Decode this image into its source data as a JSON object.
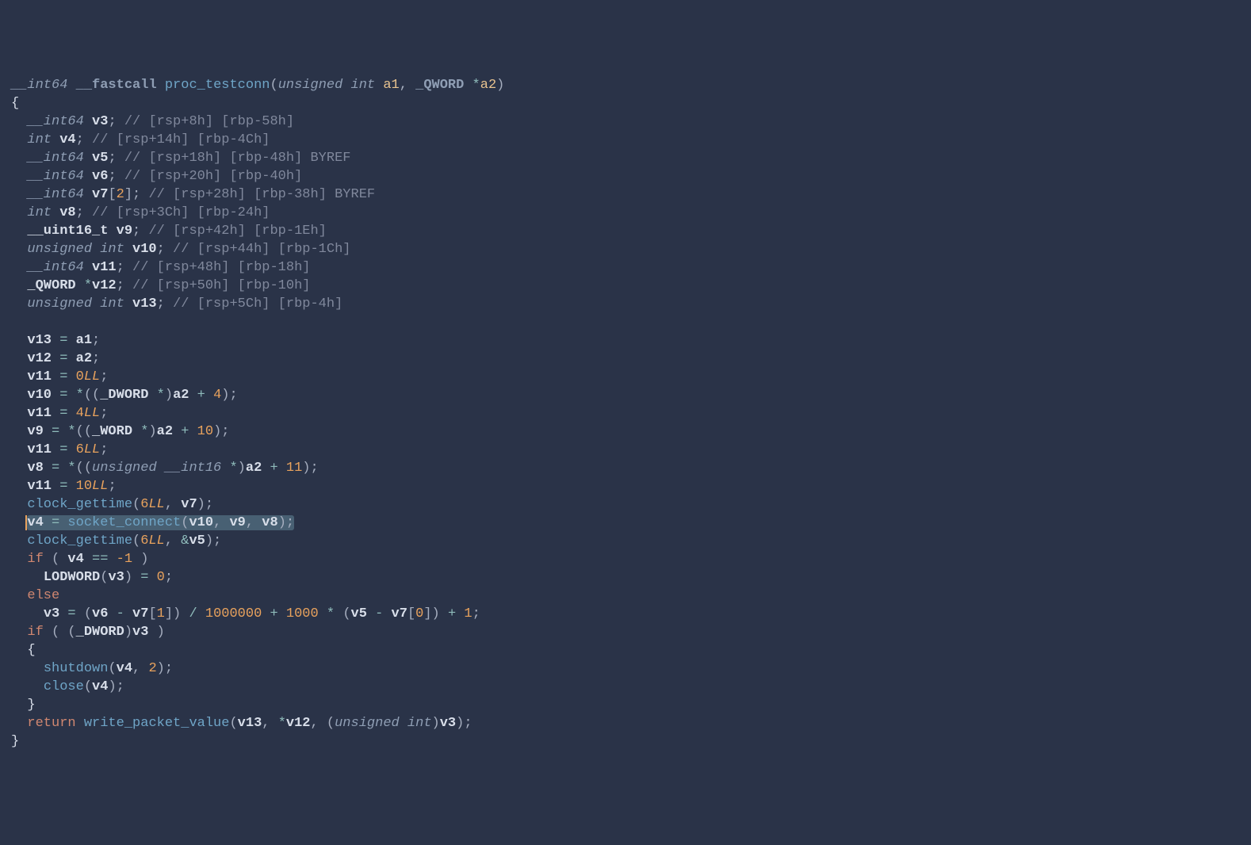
{
  "sig": {
    "ret": "__int64",
    "cc": "__fastcall",
    "name": "proc_testconn",
    "p1t": "unsigned int",
    "p1": "a1",
    "p2t": "_QWORD",
    "p2": "a2"
  },
  "decls": {
    "v3": {
      "t": "__int64",
      "c": "// [rsp+8h] [rbp-58h]"
    },
    "v4": {
      "t": "int",
      "c": "// [rsp+14h] [rbp-4Ch]"
    },
    "v5": {
      "t": "__int64",
      "c": "// [rsp+18h] [rbp-48h] BYREF"
    },
    "v6": {
      "t": "__int64",
      "c": "// [rsp+20h] [rbp-40h]"
    },
    "v7": {
      "t": "__int64",
      "arr": "2",
      "c": "// [rsp+28h] [rbp-38h] BYREF"
    },
    "v8": {
      "t": "int",
      "c": "// [rsp+3Ch] [rbp-24h]"
    },
    "v9": {
      "t": "__uint16_t",
      "c": "// [rsp+42h] [rbp-1Eh]"
    },
    "v10": {
      "t": "unsigned int",
      "c": "// [rsp+44h] [rbp-1Ch]"
    },
    "v11": {
      "t": "__int64",
      "c": "// [rsp+48h] [rbp-18h]"
    },
    "v12": {
      "t": "_QWORD",
      "ptr": "*",
      "c": "// [rsp+50h] [rbp-10h]"
    },
    "v13": {
      "t": "unsigned int",
      "c": "// [rsp+5Ch] [rbp-4h]"
    }
  },
  "body": {
    "l1": "v13",
    "l1b": "a1",
    "l2": "v12",
    "l2b": "a2",
    "l3": "v11",
    "l3n": "0",
    "l3s": "LL",
    "l4": "v10",
    "l4cast": "_DWORD",
    "l4b": "a2",
    "l4n": "4",
    "l5": "v11",
    "l5n": "4",
    "l5s": "LL",
    "l6": "v9",
    "l6cast": "_WORD",
    "l6b": "a2",
    "l6n": "10",
    "l7": "v11",
    "l7n": "6",
    "l7s": "LL",
    "l8": "v8",
    "l8cast": "unsigned __int16",
    "l8b": "a2",
    "l8n": "11",
    "l9": "v11",
    "l9n": "10",
    "l9s": "LL",
    "l10f": "clock_gettime",
    "l10n": "6",
    "l10s": "LL",
    "l10v": "v7",
    "l11v": "v4",
    "l11f": "socket_connect",
    "l11a": "v10",
    "l11b": "v9",
    "l11c": "v8",
    "l12f": "clock_gettime",
    "l12n": "6",
    "l12s": "LL",
    "l12v": "v5",
    "l13if": "if",
    "l13v": "v4",
    "l13n": "-1",
    "l14f": "LODWORD",
    "l14a": "v3",
    "l14n": "0",
    "l15": "else",
    "l16v": "v3",
    "l16a": "v6",
    "l16b": "v7",
    "l16bi": "1",
    "l16d": "1000000",
    "l16m": "1000",
    "l16c": "v5",
    "l16d2": "v7",
    "l16d2i": "0",
    "l16p": "1",
    "l17if": "if",
    "l17cast": "_DWORD",
    "l17v": "v3",
    "l18f": "shutdown",
    "l18a": "v4",
    "l18n": "2",
    "l19f": "close",
    "l19a": "v4",
    "ret": "return",
    "retf": "write_packet_value",
    "ra": "v13",
    "rb": "v12",
    "rcast": "unsigned int",
    "rc": "v3"
  }
}
